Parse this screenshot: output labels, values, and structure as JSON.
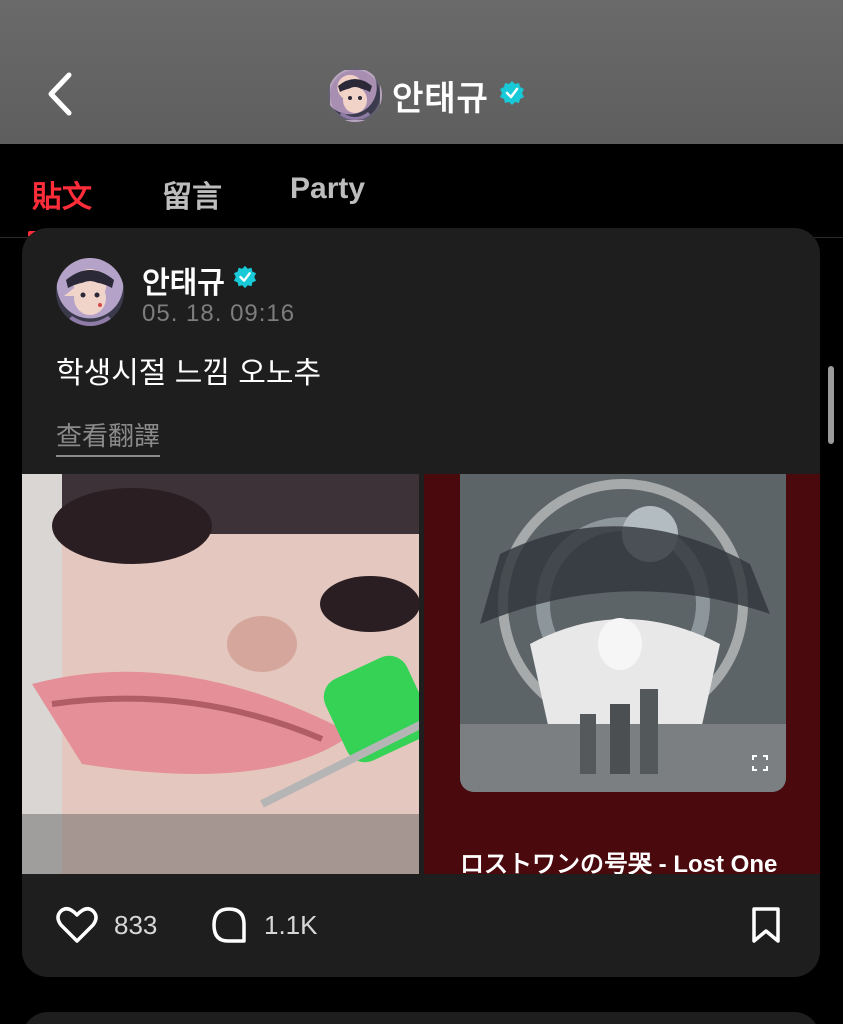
{
  "header": {
    "username": "안태규",
    "back_icon": "chevron-left-icon",
    "verified_color": "#18c9d7"
  },
  "tabs": [
    {
      "label": "貼文",
      "active": true
    },
    {
      "label": "留言",
      "active": false
    },
    {
      "label": "Party",
      "active": false
    }
  ],
  "post": {
    "username": "안태규",
    "timestamp": "05. 18. 09:16",
    "text": "학생시절 느낌 오노추",
    "translate_label": "查看翻譯",
    "song_title": "ロストワンの号哭 - Lost One",
    "likes": "833",
    "comments": "1.1K"
  },
  "colors": {
    "accent": "#ff2d3a",
    "card_bg": "#1e1e1e",
    "header_bg": "#636363",
    "verified": "#18c9d7"
  }
}
